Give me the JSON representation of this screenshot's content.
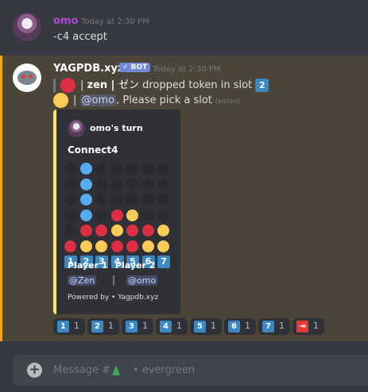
{
  "message1": {
    "username": "omo",
    "username_color": "#b04bd9",
    "timestamp": "Today at 2:30 PM",
    "text": "-c4 accept"
  },
  "message2": {
    "username": "YAGPDB.xyz",
    "bot_tag": "✓ BOT",
    "timestamp": "Today at 2:30 PM",
    "line1": {
      "player": "zen",
      "player_alt": "ゼン",
      "action": "dropped token in slot",
      "slot": "2",
      "token_color": "#dd2e44"
    },
    "line2": {
      "mention": "@omo",
      "text": ", Please pick a slot",
      "edited": "(edited)",
      "token_color": "#fdcb58"
    },
    "embed": {
      "accent_color": "#fee75c",
      "author": "omo's turn",
      "title": "Connect4",
      "board": [
        [
          "empty",
          "blue",
          "empty",
          "empty",
          "empty",
          "empty",
          "empty"
        ],
        [
          "empty",
          "blue",
          "empty",
          "empty",
          "empty",
          "empty",
          "empty"
        ],
        [
          "empty",
          "blue",
          "empty",
          "empty",
          "empty",
          "empty",
          "empty"
        ],
        [
          "empty",
          "blue",
          "empty",
          "red",
          "yellow",
          "empty",
          "empty"
        ],
        [
          "empty",
          "red",
          "red",
          "yellow",
          "red",
          "red",
          "yellow"
        ],
        [
          "red",
          "yellow",
          "yellow",
          "red",
          "red",
          "yellow",
          "yellow"
        ]
      ],
      "slot_labels": [
        "1",
        "2",
        "3",
        "4",
        "5",
        "6",
        "7"
      ],
      "player1_label": "Player 1",
      "player1_value": "@Zen",
      "player2_label": "Player 2",
      "player2_value": "@omo",
      "footer": "Powered by • Yagpdb.xyz"
    },
    "reactions": [
      {
        "emoji": "1",
        "count": "1",
        "icon": "keycap-1-icon"
      },
      {
        "emoji": "2",
        "count": "1",
        "icon": "keycap-2-icon"
      },
      {
        "emoji": "3",
        "count": "1",
        "icon": "keycap-3-icon"
      },
      {
        "emoji": "4",
        "count": "1",
        "icon": "keycap-4-icon"
      },
      {
        "emoji": "5",
        "count": "1",
        "icon": "keycap-5-icon"
      },
      {
        "emoji": "6",
        "count": "1",
        "icon": "keycap-6-icon"
      },
      {
        "emoji": "7",
        "count": "1",
        "icon": "keycap-7-icon"
      },
      {
        "emoji": "⇥",
        "count": "1",
        "icon": "exit-icon"
      }
    ]
  },
  "composer": {
    "placeholder_prefix": "Message #",
    "placeholder_suffix": "• evergreen",
    "channel_icon": "tree-icon"
  },
  "colors": {
    "background": "#36393f",
    "highlight": "#4a4538",
    "highlight_bar": "#faa61a",
    "blue": "#55acee",
    "red": "#dd2e44",
    "yellow": "#fdcb58",
    "empty": "#292b2f",
    "keycap": "#3b88c3"
  }
}
